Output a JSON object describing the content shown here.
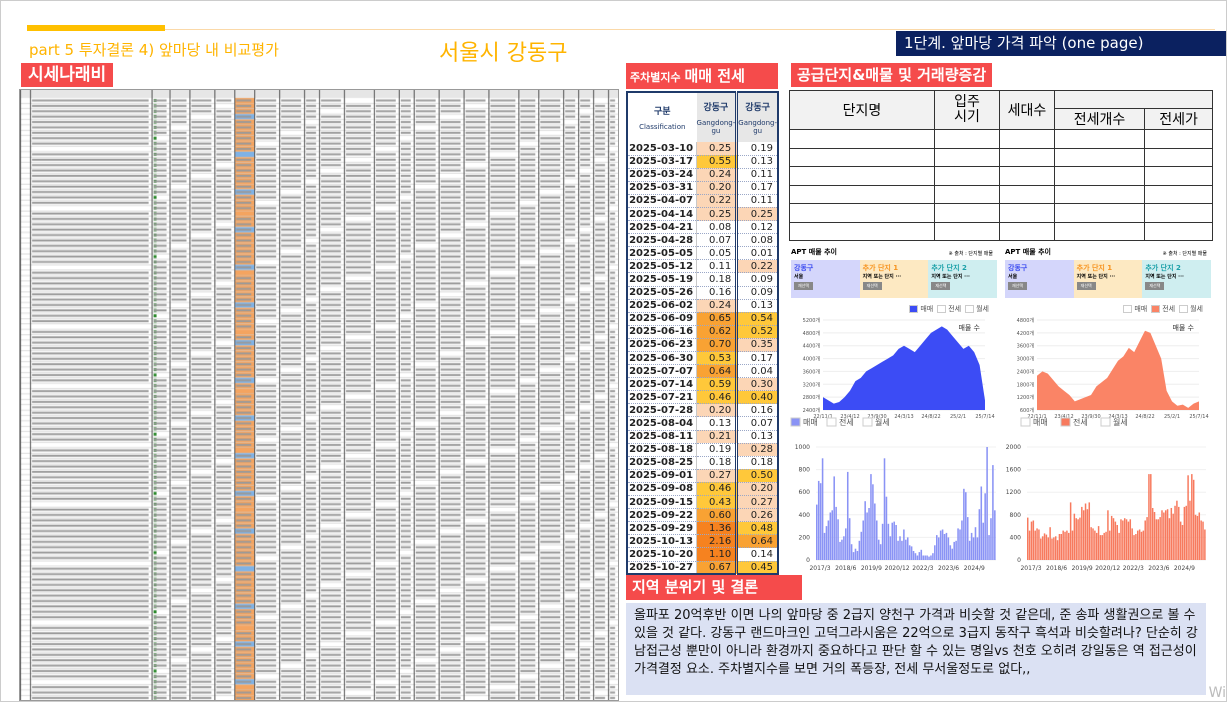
{
  "header": {
    "part_title": "part 5 투자결론 4) 앞마당 내 비교평가",
    "city": "서울시 강동구",
    "step": "1단계. 앞마당 가격 파악 (one page)"
  },
  "sections": {
    "price_list": "시세나래비",
    "weekly_prefix": "주차별지수",
    "weekly_main": "매매 전세",
    "supply": "공급단지&매물 및 거래량증감",
    "conclusion": "지역 분위기 및 결론"
  },
  "weekly": {
    "col_head": "구분",
    "col_sub": "Classification",
    "region": "강동구",
    "region_en": "Gangdong-gu",
    "rows": [
      [
        "2025-03-10",
        0.25,
        0.19
      ],
      [
        "2025-03-17",
        0.55,
        0.13
      ],
      [
        "2025-03-24",
        0.24,
        0.11
      ],
      [
        "2025-03-31",
        0.2,
        0.17
      ],
      [
        "2025-04-07",
        0.22,
        0.11
      ],
      [
        "2025-04-14",
        0.25,
        0.25
      ],
      [
        "2025-04-21",
        0.08,
        0.12
      ],
      [
        "2025-04-28",
        0.07,
        0.08
      ],
      [
        "2025-05-05",
        0.05,
        0.01
      ],
      [
        "2025-05-12",
        0.11,
        0.22
      ],
      [
        "2025-05-19",
        0.18,
        0.09
      ],
      [
        "2025-05-26",
        0.16,
        0.09
      ],
      [
        "2025-06-02",
        0.24,
        0.13
      ],
      [
        "2025-06-09",
        0.65,
        0.54
      ],
      [
        "2025-06-16",
        0.62,
        0.52
      ],
      [
        "2025-06-23",
        0.7,
        0.35
      ],
      [
        "2025-06-30",
        0.53,
        0.17
      ],
      [
        "2025-07-07",
        0.64,
        0.04
      ],
      [
        "2025-07-14",
        0.59,
        0.3
      ],
      [
        "2025-07-21",
        0.46,
        0.4
      ],
      [
        "2025-07-28",
        0.2,
        0.16
      ],
      [
        "2025-08-04",
        0.13,
        0.07
      ],
      [
        "2025-08-11",
        0.21,
        0.13
      ],
      [
        "2025-08-18",
        0.19,
        0.28
      ],
      [
        "2025-08-25",
        0.18,
        0.18
      ],
      [
        "2025-09-01",
        0.27,
        0.5
      ],
      [
        "2025-09-08",
        0.46,
        0.2
      ],
      [
        "2025-09-15",
        0.43,
        0.27
      ],
      [
        "2025-09-22",
        0.6,
        0.26
      ],
      [
        "2025-09-29",
        1.36,
        0.48
      ],
      [
        "2025-10-13",
        2.16,
        0.64
      ],
      [
        "2025-10-20",
        1.1,
        0.14
      ],
      [
        "2025-10-27",
        0.67,
        0.45
      ]
    ]
  },
  "supply_table": {
    "headers": [
      "단지명",
      "입주\n시기",
      "세대수",
      "전세개수",
      "전세가"
    ],
    "empty_rows": 6
  },
  "panels": {
    "title": "APT 매물 추이",
    "source": "※ 출처 : 단지별 매물",
    "cards": [
      {
        "name": "강동구",
        "sub": "서울",
        "btn": "재선택"
      },
      {
        "name": "추가 단지 1",
        "sub": "지역 또는 단지 ···",
        "btn": "재선택"
      },
      {
        "name": "추가 단지 2",
        "sub": "지역 또는 단지 ···",
        "btn": "재선택"
      }
    ],
    "legend": [
      "매매",
      "전세",
      "월세"
    ],
    "annot": "매물 수"
  },
  "chart_data": [
    {
      "type": "area",
      "title": "APT 매물 추이 - 매매",
      "ylim": [
        2400,
        5200
      ],
      "yticks": [
        "5200개",
        "4800개",
        "4400개",
        "4000개",
        "3600개",
        "3200개",
        "2800개",
        "2400개"
      ],
      "xticks": [
        "22/11/1",
        "23/4/12",
        "23/9/30",
        "24/3/13",
        "24/8/22",
        "25/2/1",
        "25/7/14"
      ],
      "values": [
        2800,
        2700,
        2600,
        2650,
        2800,
        3000,
        3300,
        3400,
        3600,
        3700,
        3800,
        3900,
        4000,
        4100,
        4300,
        4400,
        4300,
        4200,
        4400,
        4600,
        4800,
        4900,
        5000,
        4900,
        4700,
        4500,
        4300,
        4400,
        4200,
        3800,
        2700
      ],
      "color": "#3c4cf5"
    },
    {
      "type": "area",
      "title": "APT 매물 추이 - 전세",
      "ylim": [
        600,
        4800
      ],
      "yticks": [
        "4800개",
        "4200개",
        "3600개",
        "3000개",
        "2400개",
        "1800개",
        "1200개",
        "600개"
      ],
      "xticks": [
        "22/11/1",
        "23/4/12",
        "23/9/30",
        "24/3/13",
        "24/8/22",
        "25/2/1",
        "25/7/14"
      ],
      "values": [
        2200,
        2400,
        2300,
        2000,
        1700,
        1500,
        1300,
        1000,
        1100,
        1200,
        1300,
        1700,
        1900,
        2100,
        2500,
        2900,
        3100,
        3500,
        3300,
        3800,
        4300,
        4200,
        3600,
        3000,
        1500,
        1000,
        800,
        850,
        700,
        900,
        1000
      ],
      "color": "#fa8466"
    },
    {
      "type": "bar",
      "title": "거래량 - 매매",
      "ylim": [
        0,
        1000
      ],
      "yticks": [
        "1000",
        "800",
        "600",
        "400",
        "200",
        "0"
      ],
      "xticks": [
        "2017/3",
        "2018/6",
        "2019/9",
        "2020/12",
        "2022/3",
        "2023/6",
        "2024/9"
      ],
      "values": [
        490,
        700,
        680,
        900,
        240,
        300,
        350,
        420,
        440,
        740,
        470,
        360,
        160,
        180,
        210,
        280,
        780,
        370,
        140,
        70,
        100,
        80,
        170,
        250,
        350,
        520,
        420,
        460,
        760,
        670,
        500,
        350,
        180,
        140,
        320,
        900,
        560,
        320,
        210,
        330,
        340,
        310,
        170,
        210,
        170,
        270,
        180,
        200,
        130,
        120,
        80,
        60,
        40,
        70,
        90,
        40,
        40,
        40,
        30,
        40,
        60,
        130,
        220,
        200,
        260,
        270,
        230,
        240,
        200,
        130,
        100,
        160,
        170,
        280,
        270,
        350,
        630,
        600,
        380,
        170,
        240,
        200,
        290,
        200,
        450,
        650,
        330,
        590,
        1000,
        220,
        370,
        840,
        440
      ],
      "color": "#8a93f5"
    },
    {
      "type": "bar",
      "title": "거래량 - 전세",
      "ylim": [
        0,
        2000
      ],
      "yticks": [
        "2000",
        "1600",
        "1200",
        "800",
        "400",
        "0"
      ],
      "xticks": [
        "2017/3",
        "2018/6",
        "2019/9",
        "2020/12",
        "2022/3",
        "2023/6",
        "2024/9"
      ],
      "values": [
        750,
        520,
        680,
        700,
        520,
        560,
        540,
        380,
        420,
        470,
        450,
        400,
        580,
        380,
        400,
        420,
        350,
        460,
        460,
        520,
        500,
        520,
        480,
        1020,
        520,
        820,
        740,
        720,
        750,
        940,
        880,
        1000,
        900,
        1020,
        580,
        560,
        520,
        480,
        600,
        440,
        440,
        480,
        500,
        880,
        520,
        780,
        740,
        680,
        620,
        480,
        720,
        700,
        740,
        720,
        680,
        720,
        560,
        440,
        460,
        520,
        540,
        500,
        520,
        700,
        760,
        1520,
        1520,
        920,
        850,
        720,
        720,
        760,
        880,
        840,
        880,
        900,
        740,
        920,
        820,
        960,
        1050,
        940,
        680,
        620,
        940,
        960,
        1500,
        1050,
        1520,
        1420,
        800,
        780,
        840,
        700,
        680,
        540
      ],
      "color": "#f77a5e"
    }
  ],
  "conclusion_text": "올파포 20억후반 이면 나의 앞마당 중 2급지 양천구 가격과 비슷할 것 같은데, 준 송파 생활권으로 볼 수 있을 것 같다. 강동구 랜드마크인 고덕그라시움은 22억으로 3급지 동작구 흑석과 비슷할려나? 단순히 강남접근성 뿐만이 아니라 환경까지 중요하다고 판단 할 수 있는 명일vs 천호 오히려 강일동은 역 접근성이 가격결정 요소. 주차별지수를 보면 거의 폭등장, 전세 무서울정도로 없다,,",
  "watermark": "Wi"
}
